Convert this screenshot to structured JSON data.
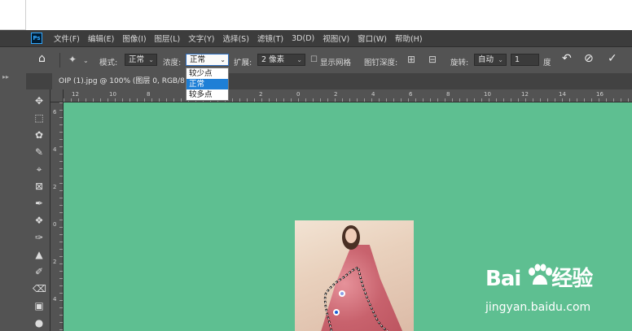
{
  "menubar": {
    "logo": "Ps",
    "items": [
      "文件(F)",
      "编辑(E)",
      "图像(I)",
      "图层(L)",
      "文字(Y)",
      "选择(S)",
      "滤镜(T)",
      "3D(D)",
      "视图(V)",
      "窗口(W)",
      "帮助(H)"
    ]
  },
  "options": {
    "mode_label": "模式:",
    "mode_value": "正常",
    "density_label": "浓度:",
    "density_value": "正常",
    "expand_label": "扩展:",
    "expand_value": "2 像素",
    "grid_label": "显示网格",
    "depth_label": "图钉深度:",
    "rotate_label": "旋转:",
    "rotate_value": "自动",
    "degree_value": "1",
    "degree_unit": "度"
  },
  "dropdown": {
    "options": [
      "较少点",
      "正常",
      "较多点"
    ],
    "selected": "正常"
  },
  "tab": {
    "title": "OIP (1).jpg @ 100% (图层 0, RGB/8"
  },
  "ruler": {
    "top": [
      "12",
      "10",
      "8",
      "2",
      "0",
      "2",
      "4",
      "6",
      "8",
      "10",
      "12",
      "14",
      "16"
    ],
    "left": [
      "6",
      "4",
      "2",
      "0",
      "2",
      "4"
    ]
  },
  "watermark": {
    "brand": "Bai",
    "brand_cn": "经验",
    "url": "jingyan.baidu.com"
  },
  "colors": {
    "canvas": "#5ebf91",
    "panel": "#535353",
    "menubar": "#3c3c3c",
    "accent": "#1e7fd6"
  }
}
